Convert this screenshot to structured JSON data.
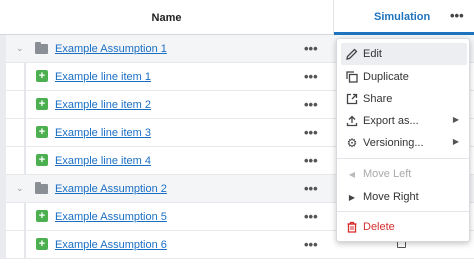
{
  "header": {
    "name_label": "Name",
    "simulation_label": "Simulation",
    "more_glyph": "•••"
  },
  "rows": [
    {
      "type": "group",
      "label": "Example Assumption 1",
      "more": "•••"
    },
    {
      "type": "item",
      "label": "Example line item 1",
      "more": "•••"
    },
    {
      "type": "item",
      "label": "Example line item 2",
      "more": "•••"
    },
    {
      "type": "item",
      "label": "Example line item 3",
      "more": "•••"
    },
    {
      "type": "item",
      "label": "Example line item 4",
      "more": "•••"
    },
    {
      "type": "group",
      "label": "Example Assumption 2",
      "more": "•••"
    },
    {
      "type": "item",
      "label": "Example Assumption 5",
      "more": "•••"
    },
    {
      "type": "item",
      "label": "Example Assumption 6",
      "more": "•••"
    }
  ],
  "menu": {
    "edit": "Edit",
    "duplicate": "Duplicate",
    "share": "Share",
    "export": "Export as...",
    "versioning": "Versioning...",
    "move_left": "Move Left",
    "move_right": "Move Right",
    "delete": "Delete"
  },
  "icons": {
    "edit": "pencil-icon",
    "duplicate": "copy-icon",
    "share": "external-link-icon",
    "export": "upload-icon",
    "versioning": "gear-icon",
    "move_left": "caret-left-icon",
    "move_right": "caret-right-icon",
    "delete": "trash-icon"
  },
  "colors": {
    "accent": "#1e73be",
    "link": "#1a6fc4",
    "add_green": "#4caf50",
    "danger": "#d32f2f"
  }
}
